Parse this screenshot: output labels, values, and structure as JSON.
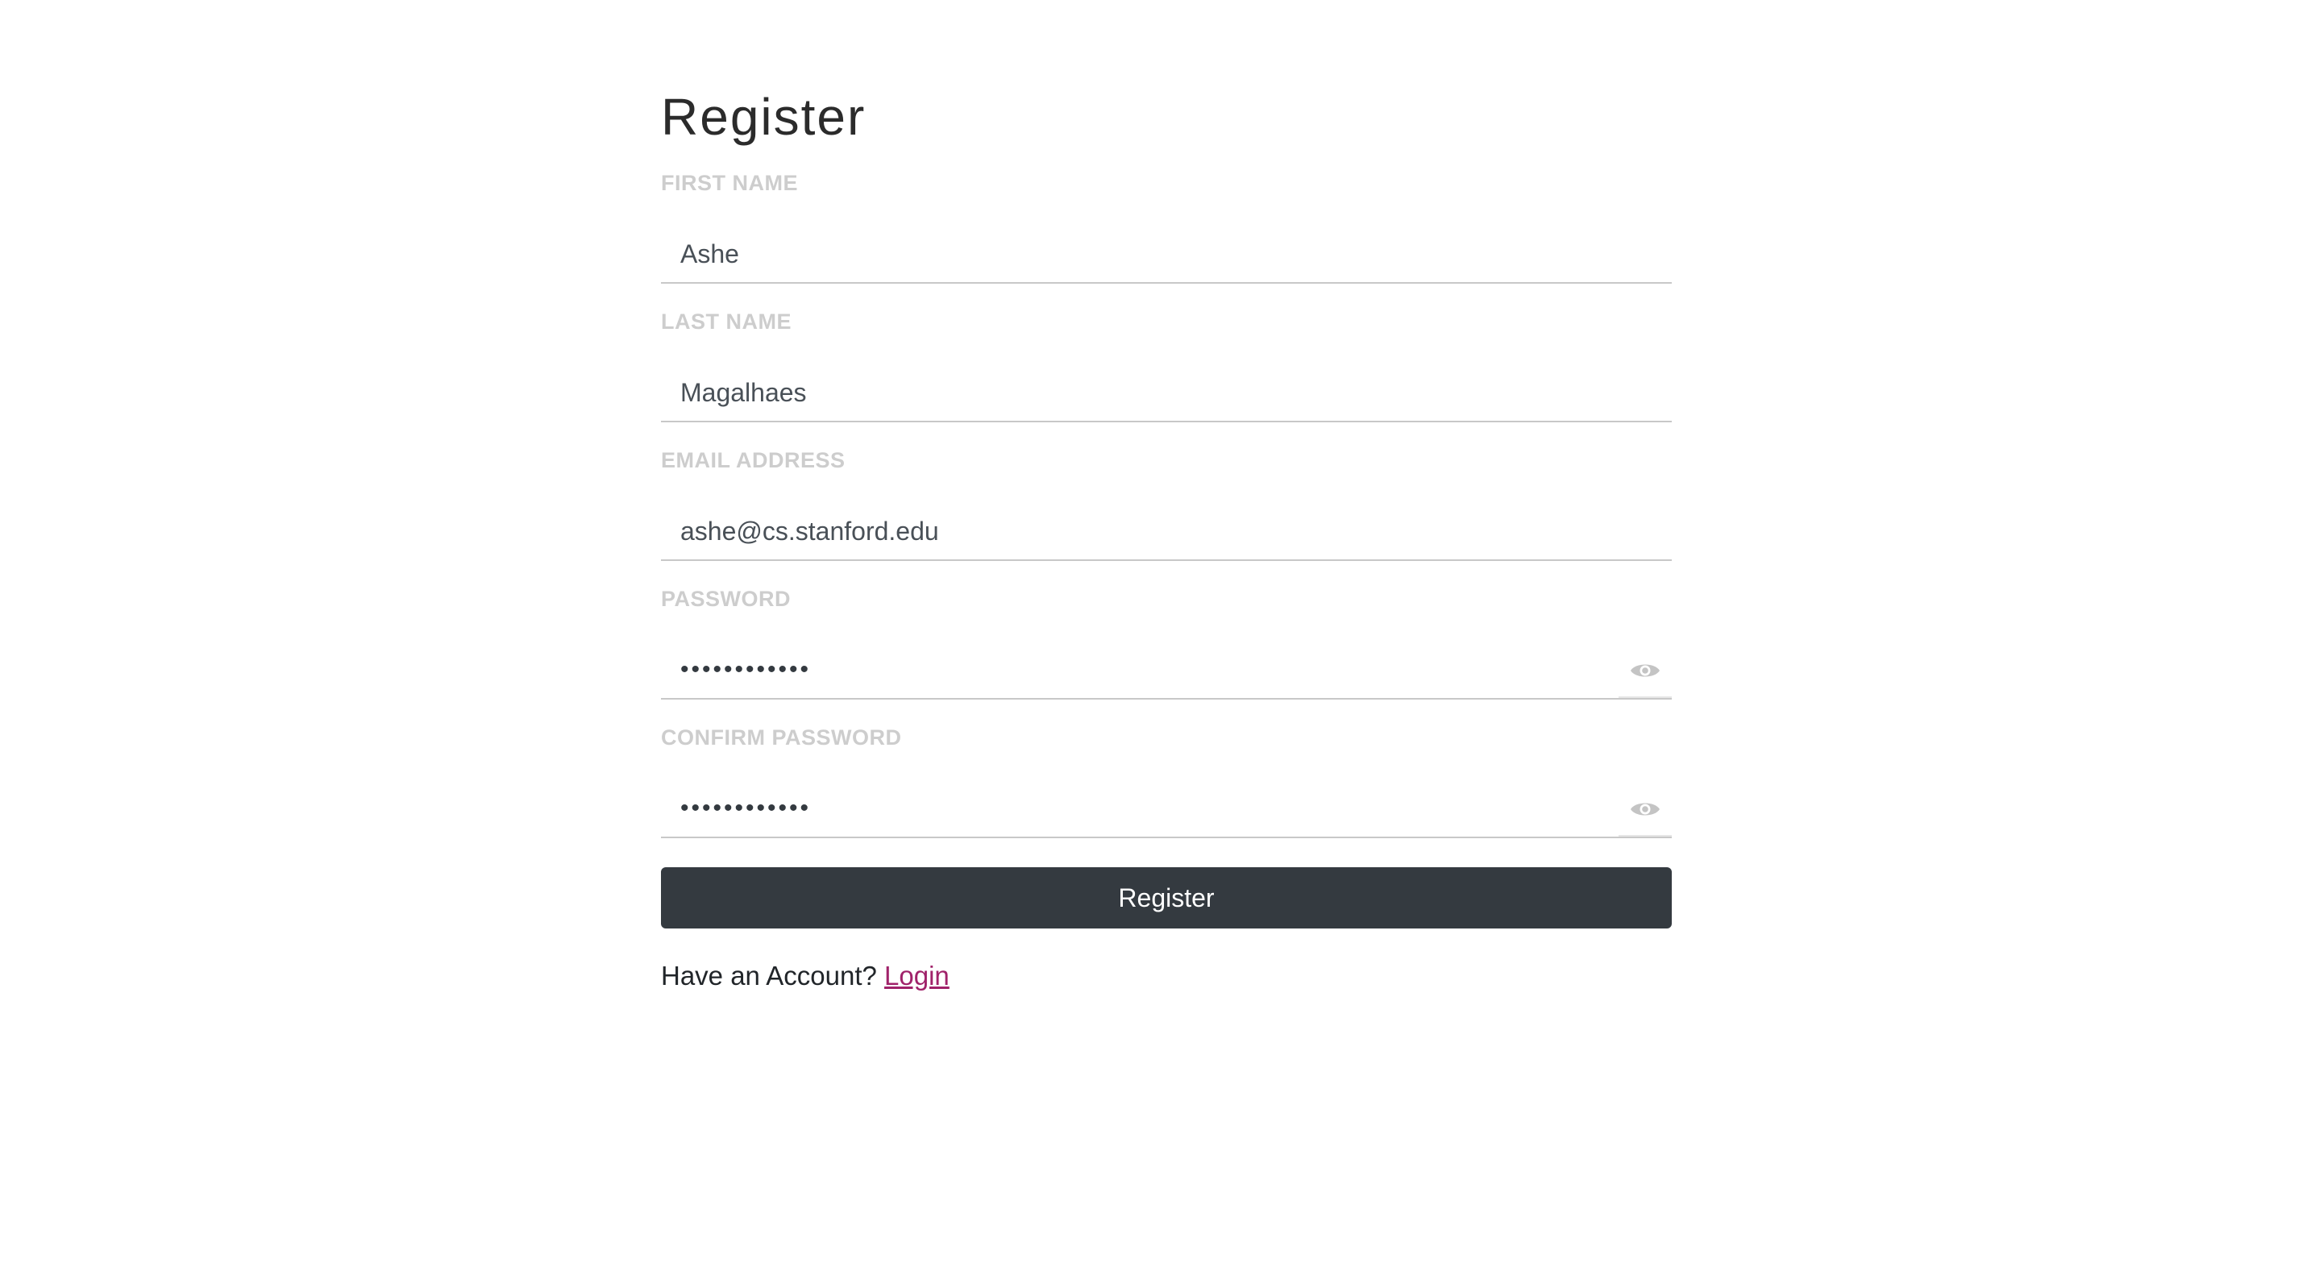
{
  "page": {
    "title": "Register"
  },
  "form": {
    "first_name": {
      "label": "FIRST NAME",
      "value": "Ashe"
    },
    "last_name": {
      "label": "LAST NAME",
      "value": "Magalhaes"
    },
    "email": {
      "label": "EMAIL ADDRESS",
      "value": "ashe@cs.stanford.edu"
    },
    "password": {
      "label": "PASSWORD",
      "value": "••••••••••••",
      "toggle_icon": "eye-icon"
    },
    "confirm_password": {
      "label": "CONFIRM PASSWORD",
      "value": "••••••••••••",
      "toggle_icon": "eye-icon"
    },
    "submit_label": "Register"
  },
  "footer": {
    "prompt": "Have an Account?",
    "login_label": "Login"
  },
  "colors": {
    "button_bg": "#343a40",
    "link": "#a0226a",
    "label": "#cdcdcd"
  }
}
